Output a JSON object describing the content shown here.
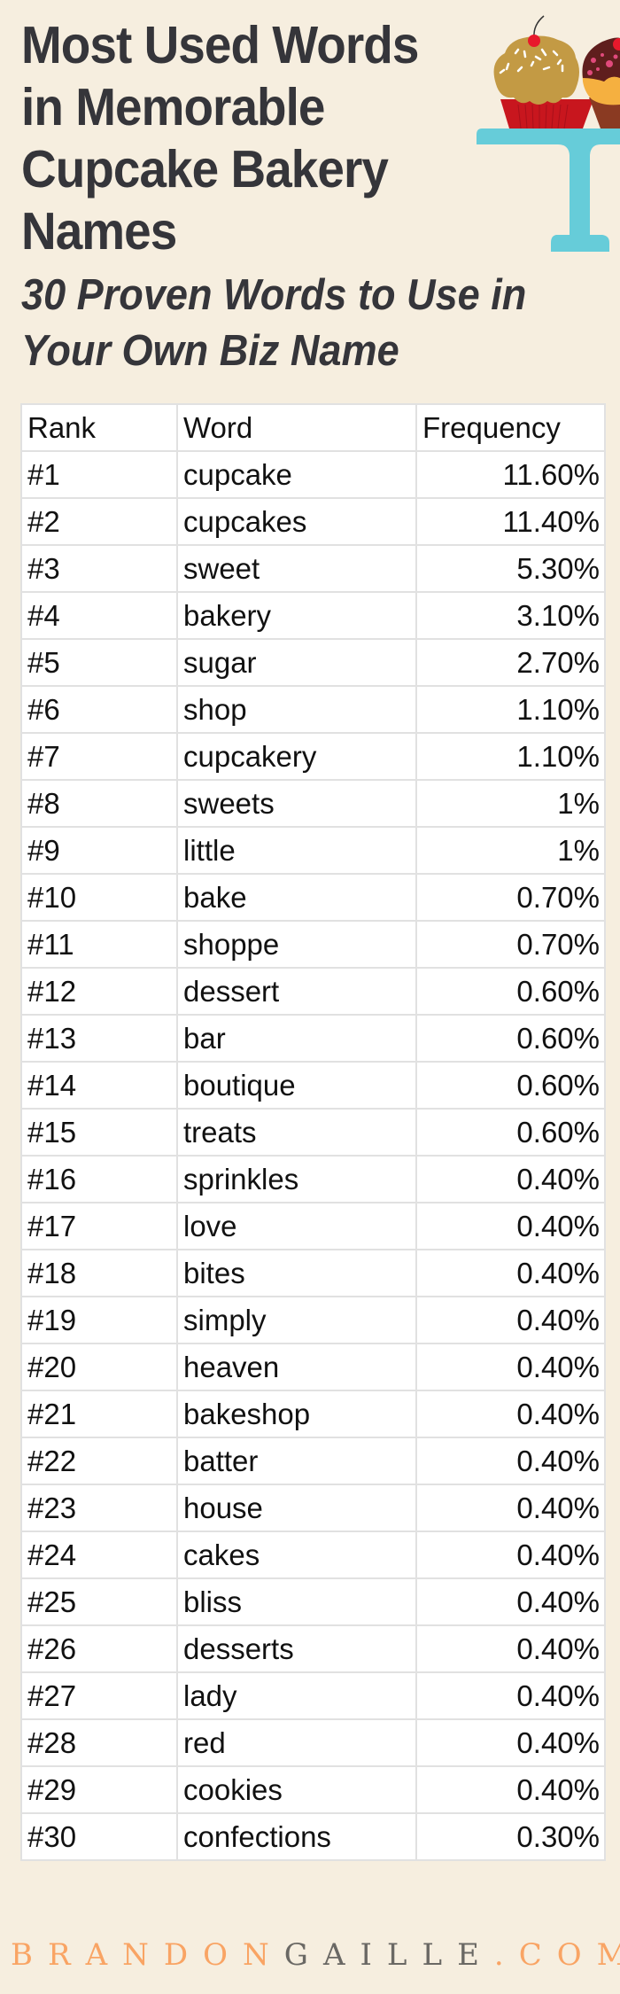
{
  "header": {
    "title_lines": [
      "Most Used Words",
      "in Memorable",
      "Cupcake Bakery",
      "Names"
    ],
    "subtitle_lines": [
      "30 Proven Words to Use in",
      "Your Own Biz Name"
    ]
  },
  "illustration": {
    "icons": [
      "cupcake-vanilla-icon",
      "cupcake-chocolate-icon",
      "cake-stand-icon"
    ],
    "colors": {
      "stand": "#66ccd9",
      "frosting_vanilla": "#c39a44",
      "wrapper_red": "#c8161e",
      "cherry": "#e8192c",
      "frosting_chocolate": "#5f1e1d",
      "cake_orange": "#f5b040",
      "wrapper_brown": "#8a3a22",
      "sprinkles_pink": "#e04a7c"
    }
  },
  "table": {
    "columns": [
      "Rank",
      "Word",
      "Frequency"
    ],
    "rows": [
      {
        "rank": "#1",
        "word": "cupcake",
        "frequency": "11.60%"
      },
      {
        "rank": "#2",
        "word": "cupcakes",
        "frequency": "11.40%"
      },
      {
        "rank": "#3",
        "word": "sweet",
        "frequency": "5.30%"
      },
      {
        "rank": "#4",
        "word": "bakery",
        "frequency": "3.10%"
      },
      {
        "rank": "#5",
        "word": "sugar",
        "frequency": "2.70%"
      },
      {
        "rank": "#6",
        "word": "shop",
        "frequency": "1.10%"
      },
      {
        "rank": "#7",
        "word": "cupcakery",
        "frequency": "1.10%"
      },
      {
        "rank": "#8",
        "word": "sweets",
        "frequency": "1%"
      },
      {
        "rank": "#9",
        "word": "little",
        "frequency": "1%"
      },
      {
        "rank": "#10",
        "word": "bake",
        "frequency": "0.70%"
      },
      {
        "rank": "#11",
        "word": "shoppe",
        "frequency": "0.70%"
      },
      {
        "rank": "#12",
        "word": "dessert",
        "frequency": "0.60%"
      },
      {
        "rank": "#13",
        "word": "bar",
        "frequency": "0.60%"
      },
      {
        "rank": "#14",
        "word": "boutique",
        "frequency": "0.60%"
      },
      {
        "rank": "#15",
        "word": "treats",
        "frequency": "0.60%"
      },
      {
        "rank": "#16",
        "word": "sprinkles",
        "frequency": "0.40%"
      },
      {
        "rank": "#17",
        "word": "love",
        "frequency": "0.40%"
      },
      {
        "rank": "#18",
        "word": "bites",
        "frequency": "0.40%"
      },
      {
        "rank": "#19",
        "word": "simply",
        "frequency": "0.40%"
      },
      {
        "rank": "#20",
        "word": "heaven",
        "frequency": "0.40%"
      },
      {
        "rank": "#21",
        "word": "bakeshop",
        "frequency": "0.40%"
      },
      {
        "rank": "#22",
        "word": "batter",
        "frequency": "0.40%"
      },
      {
        "rank": "#23",
        "word": "house",
        "frequency": "0.40%"
      },
      {
        "rank": "#24",
        "word": "cakes",
        "frequency": "0.40%"
      },
      {
        "rank": "#25",
        "word": "bliss",
        "frequency": "0.40%"
      },
      {
        "rank": "#26",
        "word": "desserts",
        "frequency": "0.40%"
      },
      {
        "rank": "#27",
        "word": "lady",
        "frequency": "0.40%"
      },
      {
        "rank": "#28",
        "word": "red",
        "frequency": "0.40%"
      },
      {
        "rank": "#29",
        "word": "cookies",
        "frequency": "0.40%"
      },
      {
        "rank": "#30",
        "word": "confections",
        "frequency": "0.30%"
      }
    ]
  },
  "footer": {
    "brand_part1": "BRANDON",
    "brand_part2": "GAILLE",
    "brand_dot": ".",
    "brand_part3": "COM",
    "colors": {
      "accent": "#f9a464",
      "muted": "#6a6864"
    }
  },
  "theme": {
    "background": "#f6eedf",
    "text": "#35353a",
    "table_border": "#e1e1e1"
  }
}
